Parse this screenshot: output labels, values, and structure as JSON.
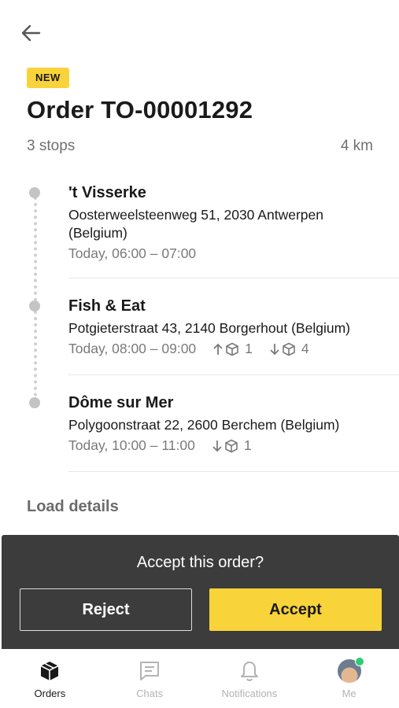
{
  "header": {
    "badge": "NEW",
    "title": "Order TO-00001292",
    "stops": "3 stops",
    "distance": "4 km"
  },
  "stops": [
    {
      "name": "'t Visserke",
      "address": "Oosterweelsteenweg 51, 2030 Antwerpen (Belgium)",
      "time": "Today, 06:00 – 07:00"
    },
    {
      "name": "Fish & Eat",
      "address": "Potgieterstraat 43, 2140 Borgerhout (Belgium)",
      "time": "Today, 08:00 – 09:00",
      "pickup_count": "1",
      "dropoff_count": "4"
    },
    {
      "name": "Dôme sur Mer",
      "address": "Polygoonstraat 22, 2600 Berchem (Belgium)",
      "time": "Today, 10:00 – 11:00",
      "dropoff_count": "1"
    }
  ],
  "load_details": "Load details",
  "sheet": {
    "question": "Accept this order?",
    "reject": "Reject",
    "accept": "Accept"
  },
  "nav": [
    {
      "label": "Orders",
      "icon": "box-icon",
      "active": true
    },
    {
      "label": "Chats",
      "icon": "chat-icon"
    },
    {
      "label": "Notifications",
      "icon": "bell-icon"
    },
    {
      "label": "Me",
      "icon": "avatar"
    }
  ],
  "colors": {
    "accent": "#f9d33a",
    "sheet": "#3c3c3c",
    "muted": "#7a7a7a",
    "online": "#2ecc71"
  }
}
